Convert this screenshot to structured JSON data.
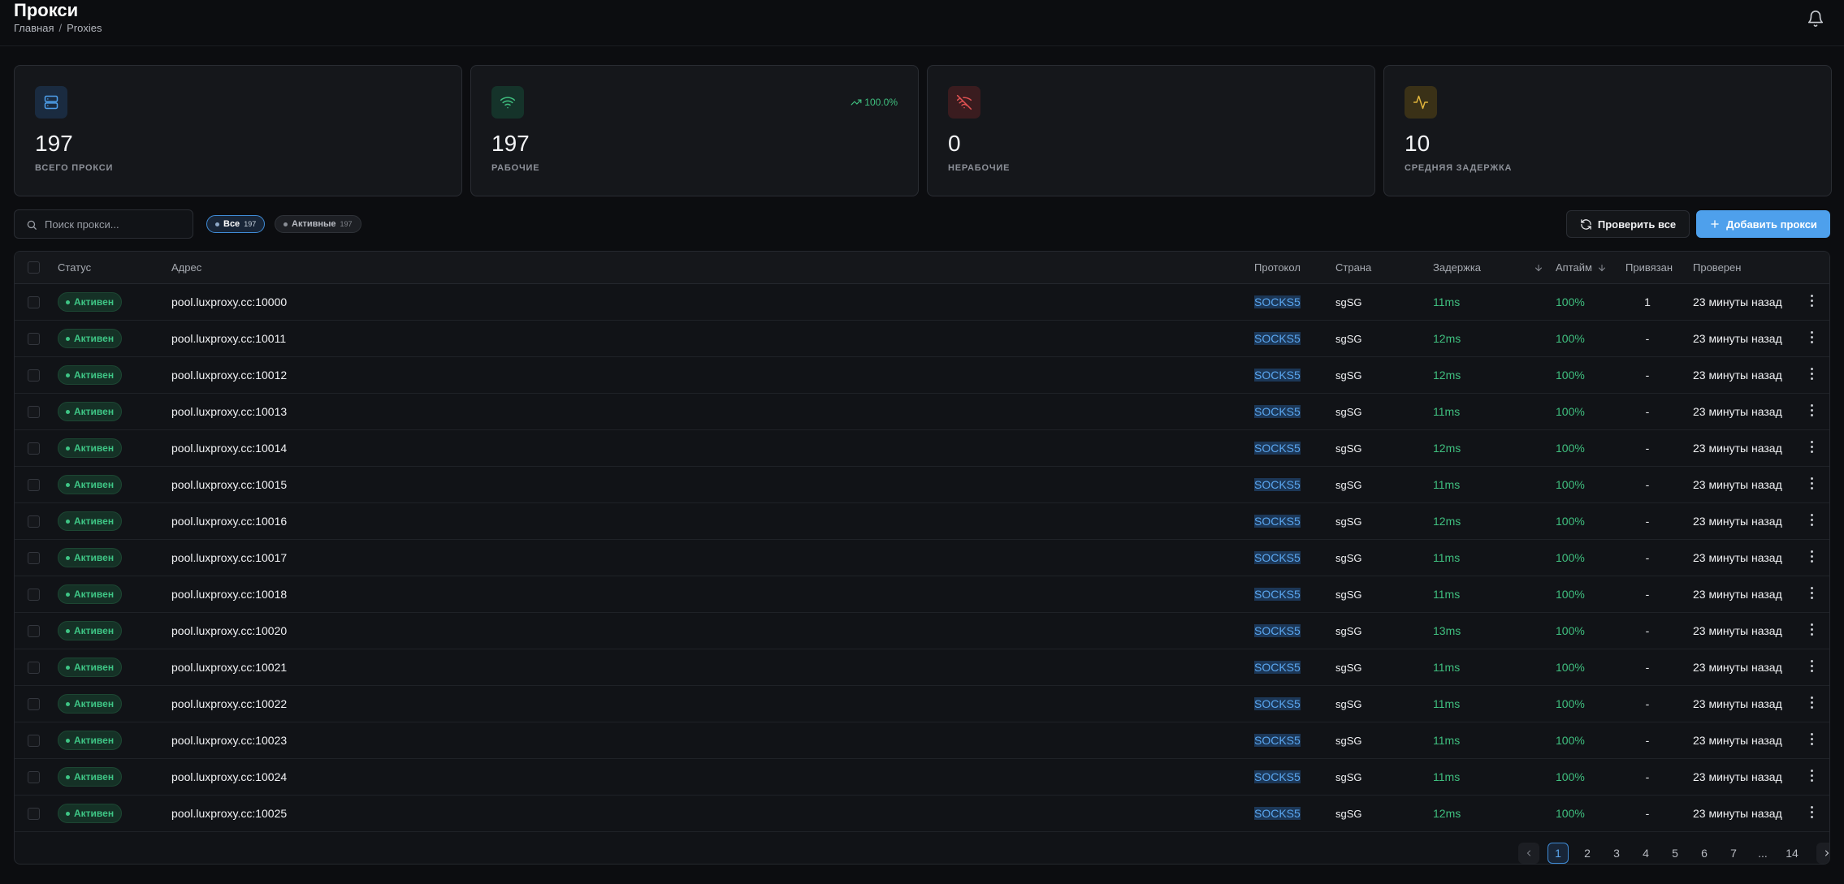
{
  "header": {
    "title": "Прокси",
    "breadcrumb": {
      "home": "Главная",
      "sep": "/",
      "current": "Proxies"
    }
  },
  "stats": [
    {
      "value": "197",
      "label": "ВСЕГО ПРОКСИ",
      "icon": "server-icon",
      "color": "#4ea0ec"
    },
    {
      "value": "197",
      "label": "РАБОЧИЕ",
      "icon": "wifi-icon",
      "color": "#3fbf7f",
      "trend": "100.0%"
    },
    {
      "value": "0",
      "label": "НЕРАБОЧИЕ",
      "icon": "wifi-off-icon",
      "color": "#e05252"
    },
    {
      "value": "10",
      "label": "СРЕДНЯЯ ЗАДЕРЖКА",
      "icon": "activity-icon",
      "color": "#e0b43c"
    }
  ],
  "toolbar": {
    "search_placeholder": "Поиск прокси...",
    "filter_all": {
      "label": "Все",
      "count": "197"
    },
    "filter_active": {
      "label": "Активные",
      "count": "197"
    },
    "check_all": "Проверить все",
    "add_proxy": "Добавить прокси"
  },
  "table": {
    "columns": {
      "status": "Статус",
      "address": "Адрес",
      "protocol": "Протокол",
      "country": "Страна",
      "latency": "Задержка",
      "uptime": "Аптайм",
      "bound": "Привязан",
      "checked": "Проверен"
    },
    "rows": [
      {
        "status": "Активен",
        "address": "pool.luxproxy.cc:10000",
        "protocol": "SOCKS5",
        "country": "sgSG",
        "latency": "11ms",
        "uptime": "100%",
        "bound": "1",
        "checked": "23 минуты назад"
      },
      {
        "status": "Активен",
        "address": "pool.luxproxy.cc:10011",
        "protocol": "SOCKS5",
        "country": "sgSG",
        "latency": "12ms",
        "uptime": "100%",
        "bound": "-",
        "checked": "23 минуты назад"
      },
      {
        "status": "Активен",
        "address": "pool.luxproxy.cc:10012",
        "protocol": "SOCKS5",
        "country": "sgSG",
        "latency": "12ms",
        "uptime": "100%",
        "bound": "-",
        "checked": "23 минуты назад"
      },
      {
        "status": "Активен",
        "address": "pool.luxproxy.cc:10013",
        "protocol": "SOCKS5",
        "country": "sgSG",
        "latency": "11ms",
        "uptime": "100%",
        "bound": "-",
        "checked": "23 минуты назад"
      },
      {
        "status": "Активен",
        "address": "pool.luxproxy.cc:10014",
        "protocol": "SOCKS5",
        "country": "sgSG",
        "latency": "12ms",
        "uptime": "100%",
        "bound": "-",
        "checked": "23 минуты назад"
      },
      {
        "status": "Активен",
        "address": "pool.luxproxy.cc:10015",
        "protocol": "SOCKS5",
        "country": "sgSG",
        "latency": "11ms",
        "uptime": "100%",
        "bound": "-",
        "checked": "23 минуты назад"
      },
      {
        "status": "Активен",
        "address": "pool.luxproxy.cc:10016",
        "protocol": "SOCKS5",
        "country": "sgSG",
        "latency": "12ms",
        "uptime": "100%",
        "bound": "-",
        "checked": "23 минуты назад"
      },
      {
        "status": "Активен",
        "address": "pool.luxproxy.cc:10017",
        "protocol": "SOCKS5",
        "country": "sgSG",
        "latency": "11ms",
        "uptime": "100%",
        "bound": "-",
        "checked": "23 минуты назад"
      },
      {
        "status": "Активен",
        "address": "pool.luxproxy.cc:10018",
        "protocol": "SOCKS5",
        "country": "sgSG",
        "latency": "11ms",
        "uptime": "100%",
        "bound": "-",
        "checked": "23 минуты назад"
      },
      {
        "status": "Активен",
        "address": "pool.luxproxy.cc:10020",
        "protocol": "SOCKS5",
        "country": "sgSG",
        "latency": "13ms",
        "uptime": "100%",
        "bound": "-",
        "checked": "23 минуты назад"
      },
      {
        "status": "Активен",
        "address": "pool.luxproxy.cc:10021",
        "protocol": "SOCKS5",
        "country": "sgSG",
        "latency": "11ms",
        "uptime": "100%",
        "bound": "-",
        "checked": "23 минуты назад"
      },
      {
        "status": "Активен",
        "address": "pool.luxproxy.cc:10022",
        "protocol": "SOCKS5",
        "country": "sgSG",
        "latency": "11ms",
        "uptime": "100%",
        "bound": "-",
        "checked": "23 минуты назад"
      },
      {
        "status": "Активен",
        "address": "pool.luxproxy.cc:10023",
        "protocol": "SOCKS5",
        "country": "sgSG",
        "latency": "11ms",
        "uptime": "100%",
        "bound": "-",
        "checked": "23 минуты назад"
      },
      {
        "status": "Активен",
        "address": "pool.luxproxy.cc:10024",
        "protocol": "SOCKS5",
        "country": "sgSG",
        "latency": "11ms",
        "uptime": "100%",
        "bound": "-",
        "checked": "23 минуты назад"
      },
      {
        "status": "Активен",
        "address": "pool.luxproxy.cc:10025",
        "protocol": "SOCKS5",
        "country": "sgSG",
        "latency": "12ms",
        "uptime": "100%",
        "bound": "-",
        "checked": "23 минуты назад"
      }
    ]
  },
  "pagination": {
    "current": "1",
    "pages": [
      "1",
      "2",
      "3",
      "4",
      "5",
      "6",
      "7",
      "...",
      "14"
    ]
  }
}
